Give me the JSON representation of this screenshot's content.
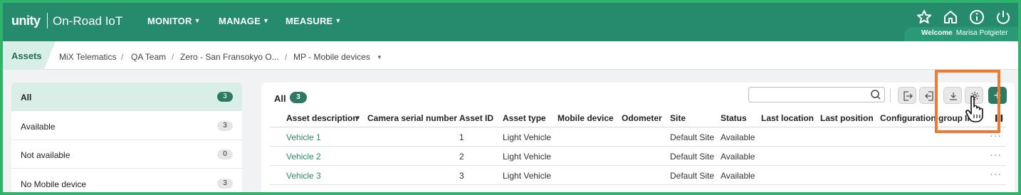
{
  "header": {
    "logo": "unity",
    "app_title": "On-Road IoT",
    "nav": [
      {
        "label": "MONITOR"
      },
      {
        "label": "MANAGE"
      },
      {
        "label": "MEASURE"
      }
    ],
    "welcome_prefix": "Welcome",
    "user_name": "Marisa Potgieter",
    "icons": [
      "star-icon",
      "home-icon",
      "info-icon",
      "power-icon"
    ]
  },
  "breadcrumb": {
    "section": "Assets",
    "items": [
      "MiX Telematics",
      "QA Team",
      "Zero - San Fransokyo O...",
      "MP - Mobile devices"
    ]
  },
  "filters": [
    {
      "label": "All",
      "count": "3",
      "active": true
    },
    {
      "label": "Available",
      "count": "3"
    },
    {
      "label": "Not available",
      "count": "0"
    },
    {
      "label": "No Mobile device",
      "count": "3"
    }
  ],
  "main": {
    "title": "All",
    "count": "3",
    "search": {
      "value": "",
      "placeholder": ""
    },
    "toolbar": [
      "export-icon",
      "import-icon",
      "download-icon",
      "settings-icon",
      "add-icon"
    ],
    "add_label": "+"
  },
  "table": {
    "columns": [
      "Asset description",
      "Camera serial number",
      "Asset ID",
      "Asset type",
      "Mobile device",
      "Odometer",
      "Site",
      "Status",
      "Last location",
      "Last position",
      "Configuration group",
      "In"
    ],
    "rows": [
      {
        "description": "Vehicle 1",
        "camera": "",
        "asset_id": "1",
        "asset_type": "Light Vehicle",
        "mobile": "",
        "odometer": "",
        "site": "Default Site",
        "status": "Available",
        "last_location": "",
        "last_position": "",
        "config": ""
      },
      {
        "description": "Vehicle 2",
        "camera": "",
        "asset_id": "2",
        "asset_type": "Light Vehicle",
        "mobile": "",
        "odometer": "",
        "site": "Default Site",
        "status": "Available",
        "last_location": "",
        "last_position": "",
        "config": ""
      },
      {
        "description": "Vehicle 3",
        "camera": "",
        "asset_id": "3",
        "asset_type": "Light Vehicle",
        "mobile": "",
        "odometer": "",
        "site": "Default Site",
        "status": "Available",
        "last_location": "",
        "last_position": "",
        "config": ""
      }
    ],
    "row_menu": "···"
  },
  "colors": {
    "brand": "#268a6c",
    "accent": "#2c7a63",
    "link": "#2a8a6c",
    "highlight": "#ef7a32",
    "frame": "#2fb36d"
  }
}
